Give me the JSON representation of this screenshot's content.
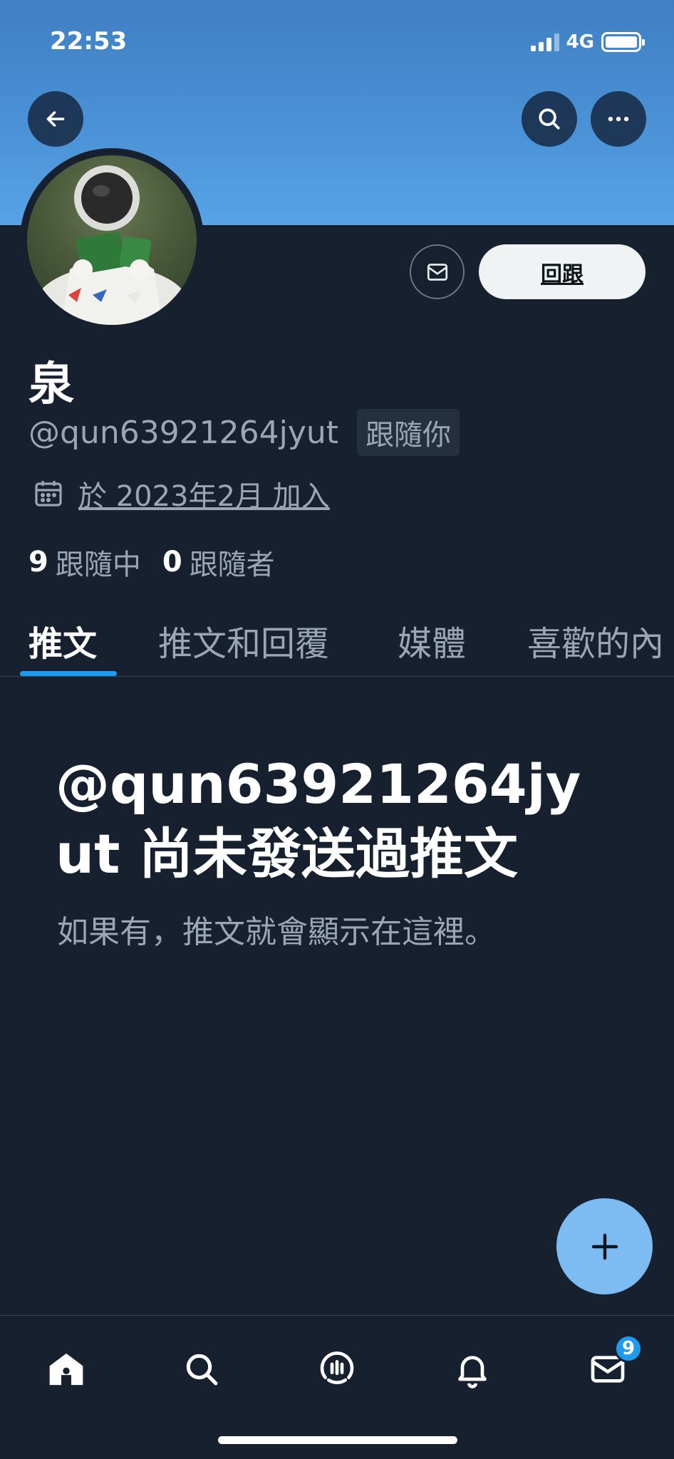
{
  "status_bar": {
    "time": "22:53",
    "network": "4G"
  },
  "profile": {
    "name": "泉",
    "handle": "@qun63921264jyut",
    "follows_you": "跟隨你",
    "joined": "於 2023年2月 加入",
    "following_count": "9",
    "following_label": "跟隨中",
    "followers_count": "0",
    "followers_label": "跟隨者",
    "follow_back_label": "回跟"
  },
  "tabs": [
    {
      "label": "推文",
      "active": true
    },
    {
      "label": "推文和回覆",
      "active": false
    },
    {
      "label": "媒體",
      "active": false
    },
    {
      "label": "喜歡的內",
      "active": false
    }
  ],
  "empty_state": {
    "title": "@qun63921264jyut 尚未發送過推文",
    "subtitle": "如果有，推文就會顯示在這裡。"
  },
  "bottom_nav": {
    "items": [
      "home-icon",
      "search-icon",
      "spaces-icon",
      "notifications-icon",
      "messages-icon"
    ],
    "messages_badge": "9"
  },
  "colors": {
    "accent": "#1d9bf0",
    "background": "#16202e",
    "fab": "#7cbcf3"
  }
}
